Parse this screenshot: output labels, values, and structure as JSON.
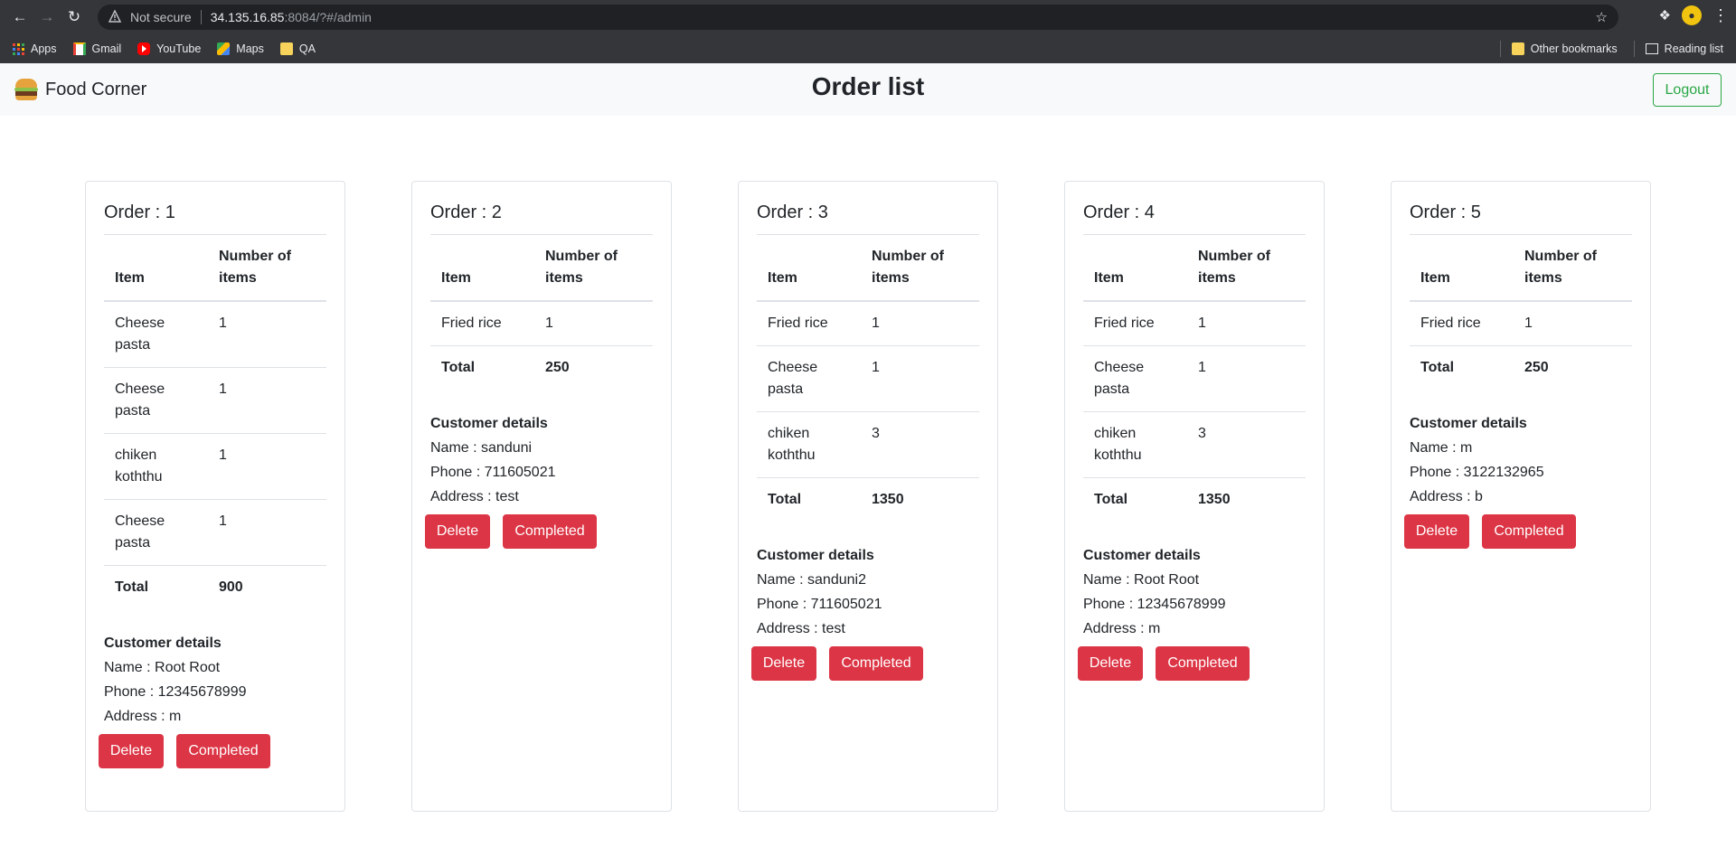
{
  "browser": {
    "security_label": "Not secure",
    "url_host": "34.135.16.85",
    "url_path": ":8084/?#/admin",
    "bookmarks": [
      "Apps",
      "Gmail",
      "YouTube",
      "Maps",
      "QA"
    ],
    "other_bookmarks": "Other bookmarks",
    "reading_list": "Reading list"
  },
  "navbar": {
    "brand": "Food Corner",
    "title": "Order list",
    "logout_label": "Logout"
  },
  "labels": {
    "item_header": "Item",
    "count_header": "Number of items",
    "total_label": "Total",
    "customer_title": "Customer details",
    "delete_label": "Delete",
    "completed_label": "Completed"
  },
  "orders": [
    {
      "title": "Order : 1",
      "items": [
        {
          "name": "Cheese pasta",
          "qty": "1"
        },
        {
          "name": "Cheese pasta",
          "qty": "1"
        },
        {
          "name": "chiken koththu",
          "qty": "1"
        },
        {
          "name": "Cheese pasta",
          "qty": "1"
        }
      ],
      "total": "900",
      "name": "Name : Root Root",
      "phone": "Phone : 12345678999",
      "address": "Address : m"
    },
    {
      "title": "Order : 2",
      "items": [
        {
          "name": "Fried rice",
          "qty": "1"
        }
      ],
      "total": "250",
      "name": "Name : sanduni",
      "phone": "Phone : 711605021",
      "address": "Address : test"
    },
    {
      "title": "Order : 3",
      "items": [
        {
          "name": "Fried rice",
          "qty": "1"
        },
        {
          "name": "Cheese pasta",
          "qty": "1"
        },
        {
          "name": "chiken koththu",
          "qty": "3"
        }
      ],
      "total": "1350",
      "name": "Name : sanduni2",
      "phone": "Phone : 711605021",
      "address": "Address : test"
    },
    {
      "title": "Order : 4",
      "items": [
        {
          "name": "Fried rice",
          "qty": "1"
        },
        {
          "name": "Cheese pasta",
          "qty": "1"
        },
        {
          "name": "chiken koththu",
          "qty": "3"
        }
      ],
      "total": "1350",
      "name": "Name : Root Root",
      "phone": "Phone : 12345678999",
      "address": "Address : m"
    },
    {
      "title": "Order : 5",
      "items": [
        {
          "name": "Fried rice",
          "qty": "1"
        }
      ],
      "total": "250",
      "name": "Name : m",
      "phone": "Phone : 3122132965",
      "address": "Address : b"
    }
  ]
}
